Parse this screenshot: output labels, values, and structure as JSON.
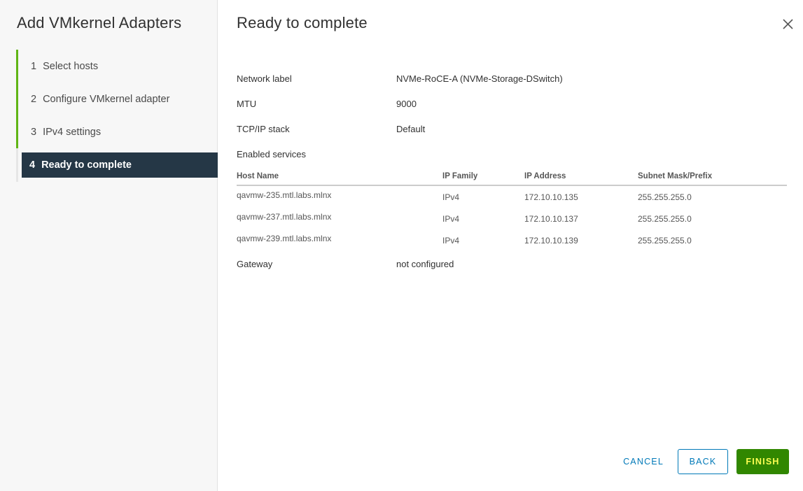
{
  "sidebar": {
    "title": "Add VMkernel Adapters",
    "steps": [
      {
        "num": "1",
        "label": "Select hosts"
      },
      {
        "num": "2",
        "label": "Configure VMkernel adapter"
      },
      {
        "num": "3",
        "label": "IPv4 settings"
      },
      {
        "num": "4",
        "label": "Ready to complete"
      }
    ]
  },
  "main": {
    "title": "Ready to complete",
    "fields": {
      "network_label": {
        "key": "Network label",
        "value": "NVMe-RoCE-A (NVMe-Storage-DSwitch)"
      },
      "mtu": {
        "key": "MTU",
        "value": "9000"
      },
      "tcpip_stack": {
        "key": "TCP/IP stack",
        "value": "Default"
      },
      "enabled_services": {
        "key": "Enabled services",
        "value": ""
      },
      "gateway": {
        "key": "Gateway",
        "value": "not configured"
      }
    },
    "table": {
      "columns": [
        "Host Name",
        "IP Family",
        "IP Address",
        "Subnet Mask/Prefix"
      ],
      "rows": [
        [
          "qavmw-235.mtl.labs.mlnx",
          "IPv4",
          "172.10.10.135",
          "255.255.255.0"
        ],
        [
          "qavmw-237.mtl.labs.mlnx",
          "IPv4",
          "172.10.10.137",
          "255.255.255.0"
        ],
        [
          "qavmw-239.mtl.labs.mlnx",
          "IPv4",
          "172.10.10.139",
          "255.255.255.0"
        ]
      ]
    }
  },
  "footer": {
    "cancel_label": "CANCEL",
    "back_label": "BACK",
    "finish_label": "FINISH"
  },
  "icons": {
    "close": "close-icon"
  },
  "colors": {
    "step_accent": "#60b515",
    "active_step_bg": "#253746",
    "link_blue": "#0079b8",
    "finish_bg": "#318700",
    "finish_text": "#ffff52"
  }
}
